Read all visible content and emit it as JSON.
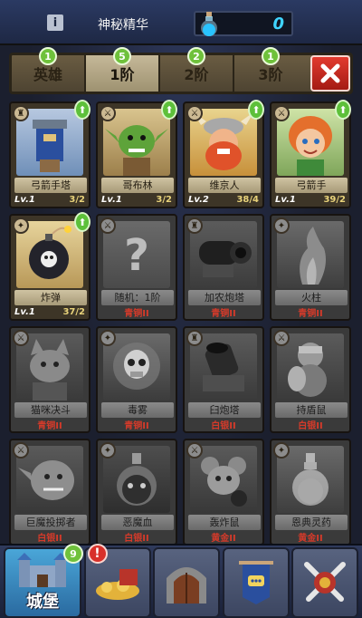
{
  "header": {
    "info_label": "i",
    "essence_label": "神秘精华",
    "essence_value": "0"
  },
  "tabs": [
    {
      "label": "英雄",
      "badge": "1"
    },
    {
      "label": "1阶",
      "badge": "5"
    },
    {
      "label": "2阶",
      "badge": "2"
    },
    {
      "label": "3阶",
      "badge": "1"
    }
  ],
  "cards": [
    {
      "name": "弓箭手塔",
      "level": "Lv.1",
      "progress": "3/2",
      "rank": "",
      "upgradable": true,
      "type_icon": "tower-icon"
    },
    {
      "name": "哥布林",
      "level": "Lv.1",
      "progress": "3/2",
      "rank": "",
      "upgradable": true,
      "type_icon": "sword-icon"
    },
    {
      "name": "维京人",
      "level": "Lv.2",
      "progress": "38/4",
      "rank": "",
      "upgradable": true,
      "type_icon": "sword-icon"
    },
    {
      "name": "弓箭手",
      "level": "Lv.1",
      "progress": "39/2",
      "rank": "",
      "upgradable": true,
      "type_icon": "sword-icon"
    },
    {
      "name": "炸弹",
      "level": "Lv.1",
      "progress": "37/2",
      "rank": "",
      "upgradable": true,
      "type_icon": "spell-icon"
    },
    {
      "name": "随机：1阶",
      "level": "",
      "progress": "",
      "rank": "青铜II",
      "upgradable": false,
      "type_icon": "sword-icon"
    },
    {
      "name": "加农炮塔",
      "level": "",
      "progress": "",
      "rank": "青铜II",
      "upgradable": false,
      "type_icon": "tower-icon"
    },
    {
      "name": "火柱",
      "level": "",
      "progress": "",
      "rank": "青铜II",
      "upgradable": false,
      "type_icon": "spell-icon"
    },
    {
      "name": "猫咪决斗",
      "level": "",
      "progress": "",
      "rank": "青铜II",
      "upgradable": false,
      "type_icon": "sword-icon"
    },
    {
      "name": "毒雾",
      "level": "",
      "progress": "",
      "rank": "青铜II",
      "upgradable": false,
      "type_icon": "spell-icon"
    },
    {
      "name": "臼炮塔",
      "level": "",
      "progress": "",
      "rank": "白银II",
      "upgradable": false,
      "type_icon": "tower-icon"
    },
    {
      "name": "持盾鼠",
      "level": "",
      "progress": "",
      "rank": "白银II",
      "upgradable": false,
      "type_icon": "sword-icon"
    },
    {
      "name": "巨魔投掷者",
      "level": "",
      "progress": "",
      "rank": "白银II",
      "upgradable": false,
      "type_icon": "sword-icon"
    },
    {
      "name": "恶魔血",
      "level": "",
      "progress": "",
      "rank": "白银II",
      "upgradable": false,
      "type_icon": "spell-icon"
    },
    {
      "name": "轰炸鼠",
      "level": "",
      "progress": "",
      "rank": "黄金II",
      "upgradable": false,
      "type_icon": "sword-icon"
    },
    {
      "name": "恩典灵药",
      "level": "",
      "progress": "",
      "rank": "黄金II",
      "upgradable": false,
      "type_icon": "spell-icon"
    }
  ],
  "bottom_nav": [
    {
      "label": "城堡",
      "badge": "9",
      "alert": "",
      "icon": "castle-icon",
      "active": true
    },
    {
      "label": "",
      "badge": "",
      "alert": "!",
      "icon": "treasure-icon",
      "active": false
    },
    {
      "label": "",
      "badge": "",
      "alert": "",
      "icon": "gate-icon",
      "active": false
    },
    {
      "label": "",
      "badge": "",
      "alert": "",
      "icon": "banner-chat-icon",
      "active": false
    },
    {
      "label": "",
      "badge": "",
      "alert": "",
      "icon": "crossed-swords-icon",
      "active": false
    }
  ]
}
